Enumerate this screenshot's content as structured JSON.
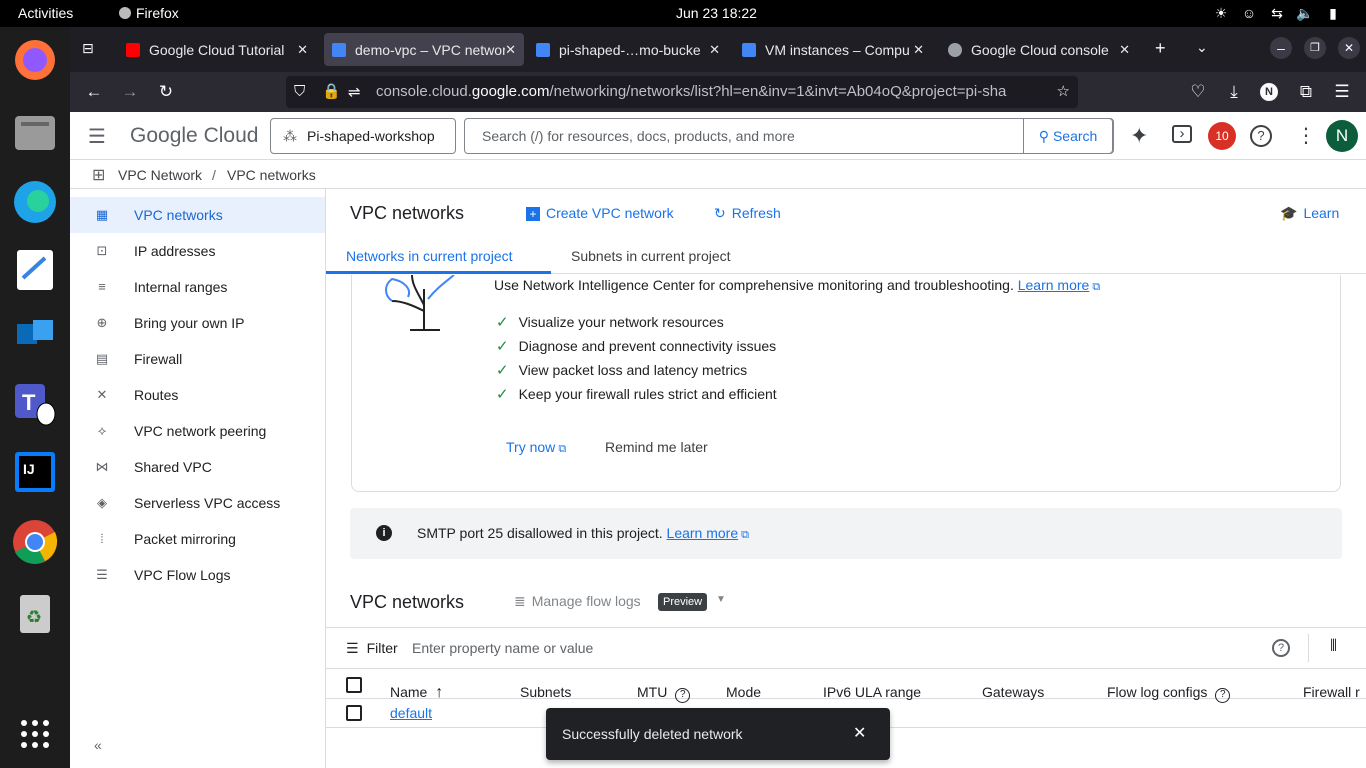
{
  "os": {
    "activities": "Activities",
    "app": "Firefox",
    "clock": "Jun 23  18:22"
  },
  "tabs": [
    {
      "title": "Google Cloud Tutorial",
      "color": "#ff0000"
    },
    {
      "title": "demo-vpc – VPC network",
      "color": "#4285f4"
    },
    {
      "title": "pi-shaped-…mo-bucke",
      "color": "#4285f4"
    },
    {
      "title": "VM instances – Compu",
      "color": "#4285f4"
    },
    {
      "title": "Google Cloud console",
      "color": "#9aa0a6"
    }
  ],
  "url": {
    "prefix": "console.cloud.",
    "domain": "google.com",
    "rest": "/networking/networks/list?hl=en&inv=1&invt=Ab04oQ&project=pi-sha"
  },
  "header": {
    "logo_google": "Google",
    "logo_cloud": "Cloud",
    "project": "Pi-shaped-workshop",
    "search_placeholder": "Search (/) for resources, docs, products, and more",
    "search_button": "Search",
    "notifications": "10",
    "avatar": "N"
  },
  "breadcrumb": {
    "product": "VPC Network",
    "page": "VPC networks"
  },
  "sidebar": {
    "items": [
      {
        "label": "VPC networks",
        "icon": "▦"
      },
      {
        "label": "IP addresses",
        "icon": "⊡"
      },
      {
        "label": "Internal ranges",
        "icon": "≡"
      },
      {
        "label": "Bring your own IP",
        "icon": "⊕"
      },
      {
        "label": "Firewall",
        "icon": "▤"
      },
      {
        "label": "Routes",
        "icon": "✕"
      },
      {
        "label": "VPC network peering",
        "icon": "⟡"
      },
      {
        "label": "Shared VPC",
        "icon": "⋈"
      },
      {
        "label": "Serverless VPC access",
        "icon": "◈"
      },
      {
        "label": "Packet mirroring",
        "icon": "⦙"
      },
      {
        "label": "VPC Flow Logs",
        "icon": "☰"
      }
    ]
  },
  "page": {
    "title": "VPC networks",
    "create": "Create VPC network",
    "refresh": "Refresh",
    "learn": "Learn",
    "tab_current": "Networks in current project",
    "tab_subnets": "Subnets in current project"
  },
  "promo": {
    "text": "Use Network Intelligence Center for comprehensive monitoring and troubleshooting.",
    "learn_more": "Learn more",
    "bullets": [
      "Visualize your network resources",
      "Diagnose and prevent connectivity issues",
      "View packet loss and latency metrics",
      "Keep your firewall rules strict and efficient"
    ],
    "try_now": "Try now",
    "remind": "Remind me later"
  },
  "smtp": {
    "text": "SMTP port 25 disallowed in this project.",
    "learn_more": "Learn more"
  },
  "table": {
    "title": "VPC networks",
    "manage": "Manage flow logs",
    "preview": "Preview",
    "filter": "Filter",
    "filter_placeholder": "Enter property name or value",
    "columns": [
      "Name",
      "Subnets",
      "MTU",
      "Mode",
      "IPv6 ULA range",
      "Gateways",
      "Flow log configs",
      "Firewall r"
    ],
    "rows": [
      {
        "name": "default"
      }
    ]
  },
  "toast": {
    "message": "Successfully deleted network"
  }
}
